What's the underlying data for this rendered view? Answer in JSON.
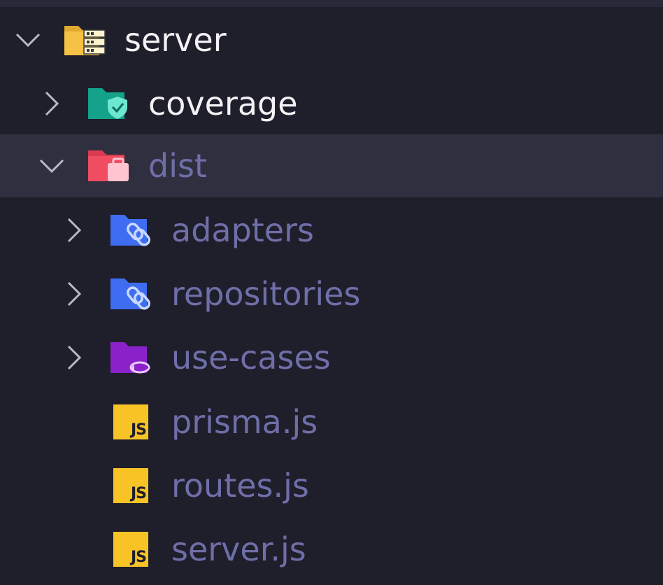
{
  "tree": {
    "root": {
      "label": "server",
      "icon": "server-folder-open-icon",
      "expanded": true
    },
    "items": [
      {
        "label": "coverage",
        "icon": "coverage-folder-icon",
        "kind": "folder",
        "expanded": false
      },
      {
        "label": "dist",
        "icon": "dist-folder-open-icon",
        "kind": "folder",
        "expanded": true,
        "selected": true
      },
      {
        "label": "adapters",
        "icon": "link-folder-icon",
        "kind": "folder",
        "expanded": false
      },
      {
        "label": "repositories",
        "icon": "link-folder-icon",
        "kind": "folder",
        "expanded": false
      },
      {
        "label": "use-cases",
        "icon": "cycle-folder-icon",
        "kind": "folder",
        "expanded": false
      },
      {
        "label": "prisma.js",
        "icon": "js-file-icon",
        "kind": "file"
      },
      {
        "label": "routes.js",
        "icon": "js-file-icon",
        "kind": "file"
      },
      {
        "label": "server.js",
        "icon": "js-file-icon",
        "kind": "file"
      }
    ],
    "js_badge_text": "JS"
  },
  "colors": {
    "background": "#1f1e2b",
    "selected_row": "#302f3f",
    "bright_text": "#f2f2f5",
    "dim_text": "#6e6fa8",
    "server_folder": "#f6c244",
    "coverage_folder": "#14a38a",
    "dist_folder": "#f04d63",
    "link_folder": "#3f6df1",
    "cycle_folder": "#8b22c9",
    "js_yellow": "#f7c325"
  }
}
